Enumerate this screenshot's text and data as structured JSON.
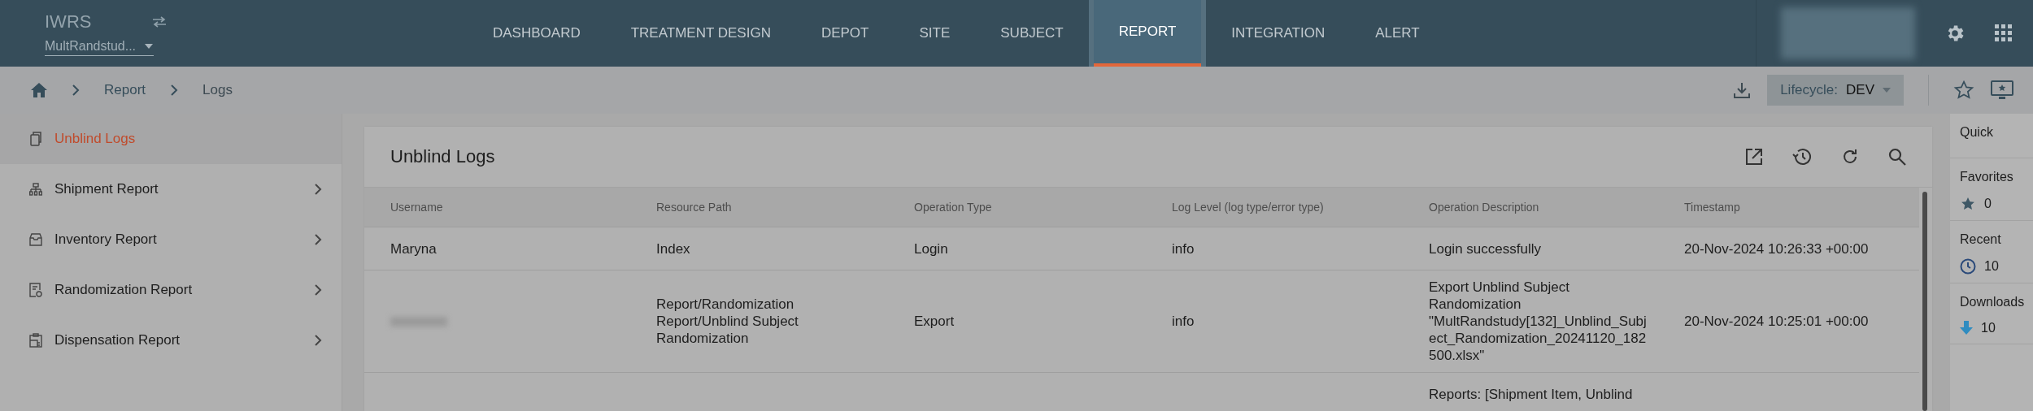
{
  "header": {
    "app_name": "IWRS",
    "study_selector": "MultRandstud...",
    "nav": [
      {
        "label": "DASHBOARD",
        "selected": false
      },
      {
        "label": "TREATMENT DESIGN",
        "selected": false
      },
      {
        "label": "DEPOT",
        "selected": false
      },
      {
        "label": "SITE",
        "selected": false
      },
      {
        "label": "SUBJECT",
        "selected": false
      },
      {
        "label": "REPORT",
        "selected": true
      },
      {
        "label": "INTEGRATION",
        "selected": false
      },
      {
        "label": "ALERT",
        "selected": false
      }
    ]
  },
  "breadcrumb": [
    "Report",
    "Logs"
  ],
  "lifecycle": {
    "label": "Lifecycle:",
    "value": "DEV"
  },
  "sidebar": {
    "items": [
      {
        "label": "Unblind Logs",
        "kind": "logs",
        "selected": true,
        "has_children": false
      },
      {
        "label": "Shipment Report",
        "kind": "shipment",
        "selected": false,
        "has_children": true
      },
      {
        "label": "Inventory Report",
        "kind": "inventory",
        "selected": false,
        "has_children": true
      },
      {
        "label": "Randomization Report",
        "kind": "randomization",
        "selected": false,
        "has_children": true
      },
      {
        "label": "Dispensation Report",
        "kind": "dispensation",
        "selected": false,
        "has_children": true
      }
    ]
  },
  "card": {
    "title": "Unblind Logs",
    "table": {
      "columns": [
        "Username",
        "Resource Path",
        "Operation Type",
        "Log Level (log type/error type)",
        "Operation Description",
        "Timestamp"
      ],
      "rows": [
        {
          "username_redacted": false,
          "username": "Maryna",
          "resource_path": "Index",
          "operation_type": "Login",
          "log_level": "info",
          "operation_description": "Login successfully",
          "timestamp": "20-Nov-2024 10:26:33 +00:00"
        },
        {
          "username_redacted": true,
          "resource_path": "Report/Randomization Report/Unblind Subject Randomization",
          "operation_type": "Export",
          "log_level": "info",
          "operation_description": "Export Unblind Subject Randomization \"MultRandstudy[132]_Unblind_Subject_Randomization_20241120_182500.xlsx\"",
          "timestamp": "20-Nov-2024 10:25:01 +00:00"
        },
        {
          "username_redacted": false,
          "operation_description": "Reports: [Shipment Item, Unblind"
        }
      ]
    }
  },
  "quick_panel": {
    "title": "Quick",
    "sections": [
      {
        "label": "Favorites",
        "kind": "favorites",
        "count": "0"
      },
      {
        "label": "Recent",
        "kind": "recent",
        "count": "10"
      },
      {
        "label": "Downloads",
        "kind": "downloads",
        "count": "10"
      }
    ]
  }
}
